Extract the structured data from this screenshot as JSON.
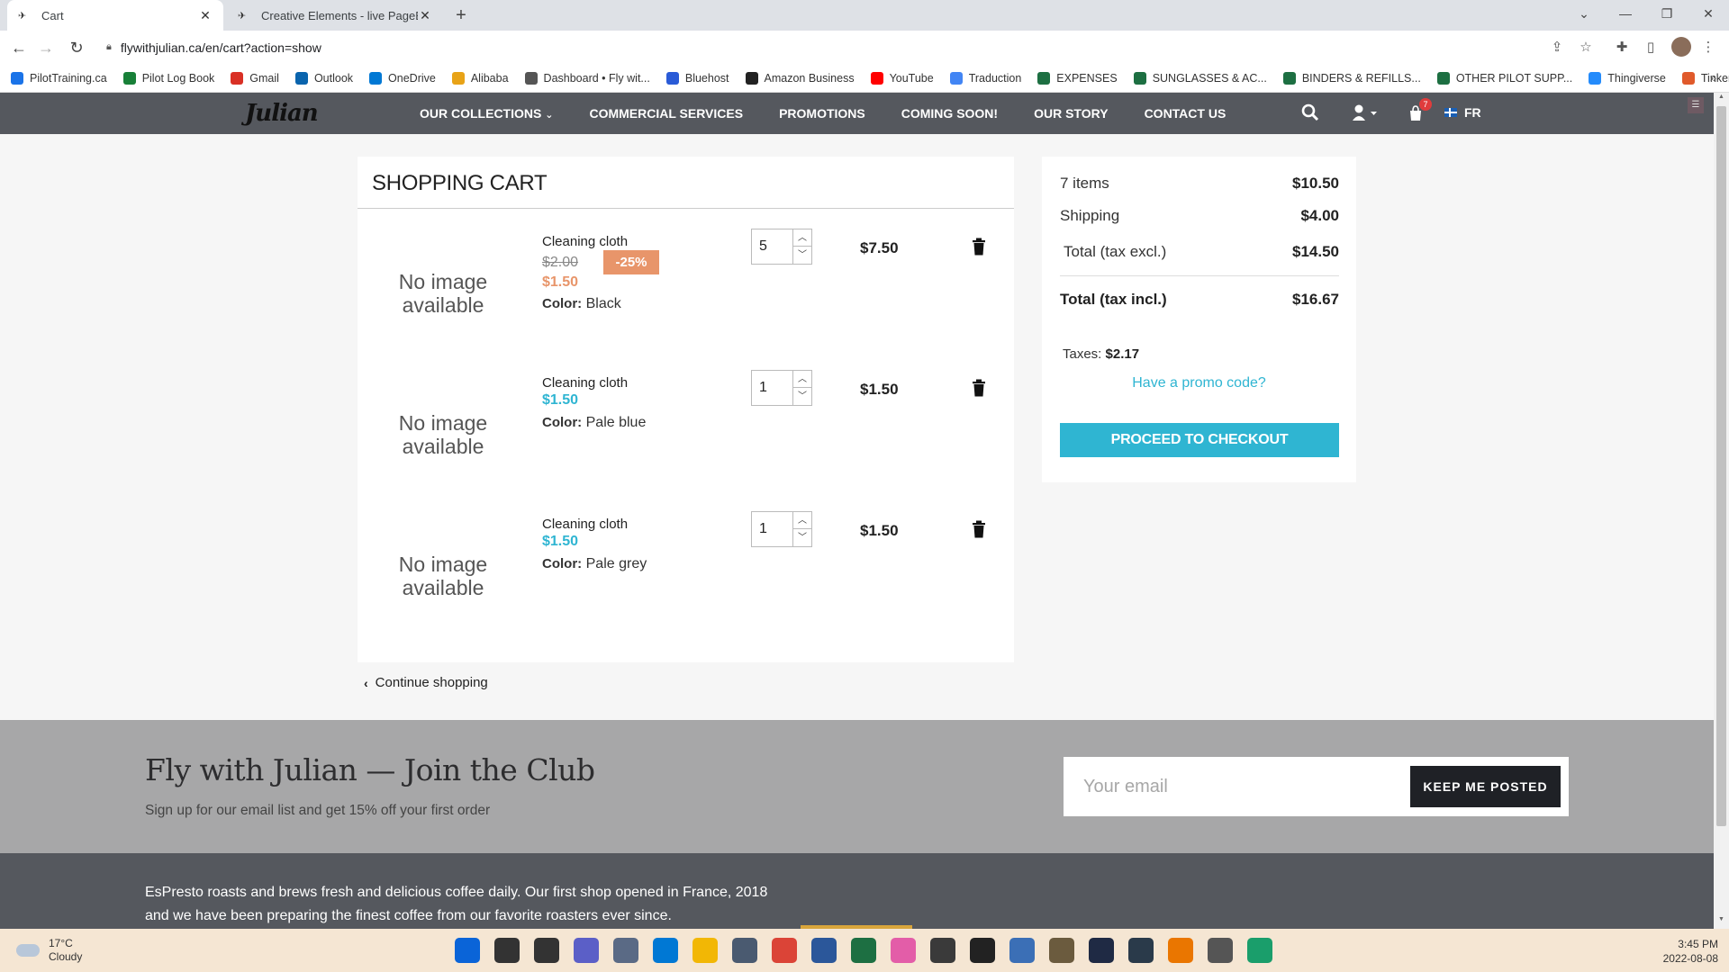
{
  "browser": {
    "tabs": [
      {
        "title": "Cart",
        "favicon": "plane-icon",
        "active": true
      },
      {
        "title": "Creative Elements - live PageBuil",
        "favicon": "plane-icon",
        "active": false
      }
    ],
    "url": "flywithjulian.ca/en/cart?action=show",
    "bookmarks": [
      {
        "label": "PilotTraining.ca",
        "icon": "plane-icon",
        "color": "#1a73e8"
      },
      {
        "label": "Pilot Log Book",
        "icon": "sheets-icon",
        "color": "#188038"
      },
      {
        "label": "Gmail",
        "icon": "gmail-icon",
        "color": "#d93025"
      },
      {
        "label": "Outlook",
        "icon": "outlook-icon",
        "color": "#0a64ad"
      },
      {
        "label": "OneDrive",
        "icon": "onedrive-icon",
        "color": "#0078d4"
      },
      {
        "label": "Alibaba",
        "icon": "alibaba-icon",
        "color": "#e8a317"
      },
      {
        "label": "Dashboard • Fly wit...",
        "icon": "plane-icon",
        "color": "#555555"
      },
      {
        "label": "Bluehost",
        "icon": "grid-icon",
        "color": "#2a5bd7"
      },
      {
        "label": "Amazon Business",
        "icon": "amazon-icon",
        "color": "#222222"
      },
      {
        "label": "YouTube",
        "icon": "youtube-icon",
        "color": "#ff0000"
      },
      {
        "label": "Traduction",
        "icon": "google-icon",
        "color": "#4285f4"
      },
      {
        "label": "EXPENSES",
        "icon": "excel-icon",
        "color": "#1d6f42"
      },
      {
        "label": "SUNGLASSES & AC...",
        "icon": "excel-icon",
        "color": "#1d6f42"
      },
      {
        "label": "BINDERS & REFILLS...",
        "icon": "excel-icon",
        "color": "#1d6f42"
      },
      {
        "label": "OTHER PILOT SUPP...",
        "icon": "excel-icon",
        "color": "#1d6f42"
      },
      {
        "label": "Thingiverse",
        "icon": "thingiverse-icon",
        "color": "#248bfb"
      },
      {
        "label": "Tinkercad",
        "icon": "tinkercad-icon",
        "color": "#e05a2b"
      }
    ]
  },
  "header": {
    "logo": "Julian",
    "nav": [
      "OUR COLLECTIONS",
      "COMMERCIAL SERVICES",
      "PROMOTIONS",
      "COMING SOON!",
      "OUR STORY",
      "CONTACT US"
    ],
    "cart_count": "7",
    "language": "FR"
  },
  "cart": {
    "title": "SHOPPING CART",
    "no_image": "No image available",
    "color_label": "Color:",
    "items": [
      {
        "name": "Cleaning cloth",
        "old_price": "$2.00",
        "discount": "-25%",
        "price": "$1.50",
        "color": "Black",
        "quantity": "5",
        "total": "$7.50"
      },
      {
        "name": "Cleaning cloth",
        "price": "$1.50",
        "color": "Pale blue",
        "quantity": "1",
        "total": "$1.50"
      },
      {
        "name": "Cleaning cloth",
        "price": "$1.50",
        "color": "Pale grey",
        "quantity": "1",
        "total": "$1.50"
      }
    ],
    "continue_label": "Continue shopping"
  },
  "summary": {
    "items_label": "7 items",
    "items_value": "$10.50",
    "shipping_label": "Shipping",
    "shipping_value": "$4.00",
    "total_excl_label": "Total (tax excl.)",
    "total_excl_value": "$14.50",
    "total_incl_label": "Total (tax incl.)",
    "total_incl_value": "$16.67",
    "taxes_label": "Taxes:",
    "taxes_value": "$2.17",
    "promo_label": "Have a promo code?",
    "checkout_label": "PROCEED TO CHECKOUT"
  },
  "newsletter": {
    "title": "Fly with Julian — Join the Club",
    "subtitle": "Sign up for our email list and get 15% off your first order",
    "placeholder": "Your email",
    "button": "KEEP ME POSTED"
  },
  "footer": {
    "text": "EsPresto roasts and brews fresh and delicious coffee daily. Our first shop opened in France, 2018 and we have been preparing the finest coffee from our favorite roasters ever since."
  },
  "taskbar": {
    "temperature": "17°C",
    "weather": "Cloudy",
    "time": "3:45 PM",
    "date": "2022-08-08",
    "apps": [
      {
        "name": "windows-start-icon",
        "color": "#0a64d8"
      },
      {
        "name": "search-icon",
        "color": "#333333"
      },
      {
        "name": "task-view-icon",
        "color": "#333333"
      },
      {
        "name": "teams-chat-icon",
        "color": "#5b5fc7"
      },
      {
        "name": "settings-icon",
        "color": "#5a6a85"
      },
      {
        "name": "snipping-tool-icon",
        "color": "#0078d4"
      },
      {
        "name": "file-explorer-icon",
        "color": "#f2b705"
      },
      {
        "name": "calculator-icon",
        "color": "#4a5a70"
      },
      {
        "name": "chrome-icon",
        "color": "#db4437"
      },
      {
        "name": "word-icon",
        "color": "#2b579a"
      },
      {
        "name": "excel-icon",
        "color": "#1d6f42"
      },
      {
        "name": "itunes-icon",
        "color": "#e35da8"
      },
      {
        "name": "davinci-icon",
        "color": "#3a3a3a"
      },
      {
        "name": "inkscape-icon",
        "color": "#222222"
      },
      {
        "name": "notepad-icon",
        "color": "#3b6fb6"
      },
      {
        "name": "gimp-icon",
        "color": "#6b5b3e"
      },
      {
        "name": "resolve-icon",
        "color": "#1f2a44"
      },
      {
        "name": "app-dark-icon",
        "color": "#2a3a4a"
      },
      {
        "name": "blender-icon",
        "color": "#ea7600"
      },
      {
        "name": "search-app-icon",
        "color": "#555555"
      },
      {
        "name": "cricut-icon",
        "color": "#1a9e6b"
      }
    ]
  }
}
